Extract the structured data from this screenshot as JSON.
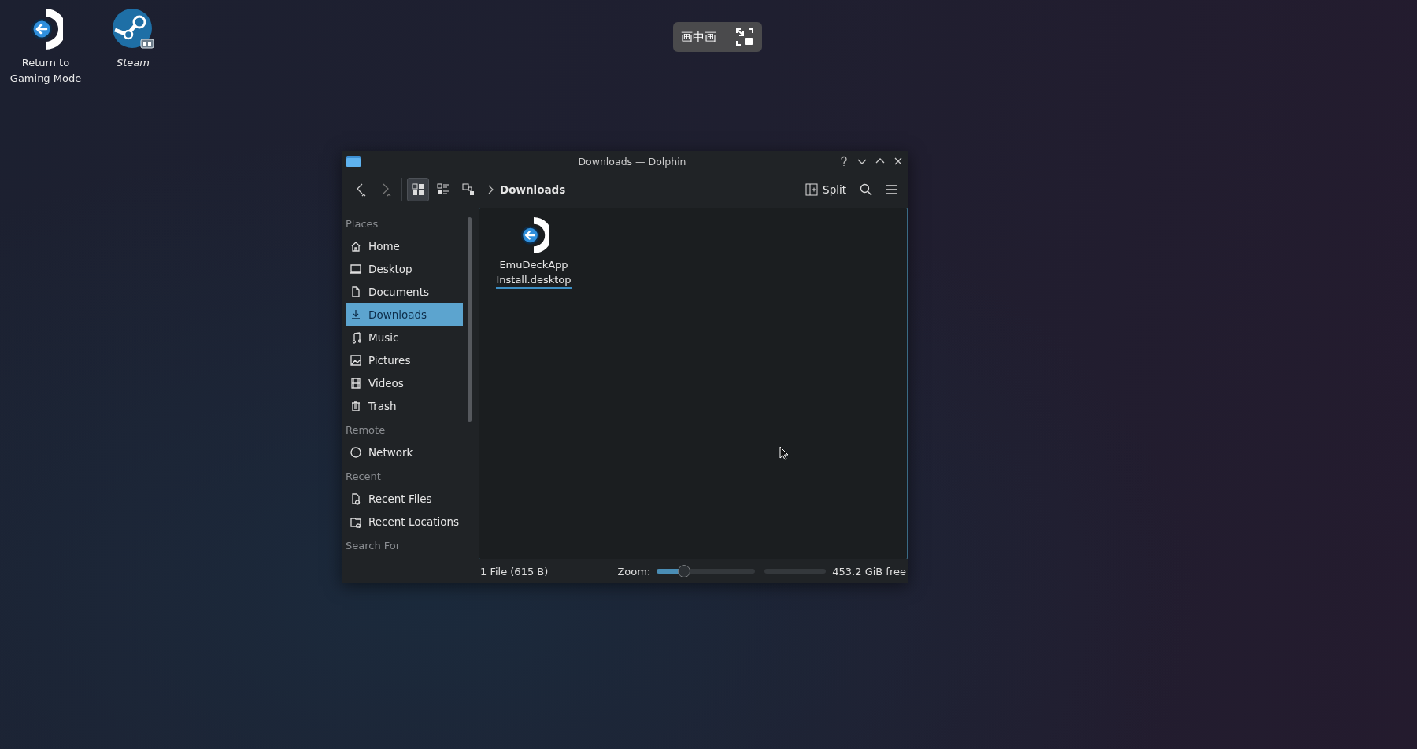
{
  "desktop_icons": [
    {
      "label": "Return to\nGaming Mode",
      "kind": "return"
    },
    {
      "label": "Steam",
      "kind": "steam"
    }
  ],
  "pip_bar": {
    "label": "画中画"
  },
  "window": {
    "title": "Downloads — Dolphin"
  },
  "toolbar": {
    "view_modes": [
      {
        "selected": true
      },
      {
        "selected": false
      },
      {
        "selected": false
      }
    ],
    "breadcrumb": "Downloads",
    "split_button": "Split"
  },
  "sidebar": {
    "sections": [
      {
        "heading": "Places",
        "items": [
          {
            "label": "Home",
            "selected": false
          },
          {
            "label": "Desktop",
            "selected": false
          },
          {
            "label": "Documents",
            "selected": false
          },
          {
            "label": "Downloads",
            "selected": true
          },
          {
            "label": "Music",
            "selected": false
          },
          {
            "label": "Pictures",
            "selected": false
          },
          {
            "label": "Videos",
            "selected": false
          },
          {
            "label": "Trash",
            "selected": false
          }
        ]
      },
      {
        "heading": "Remote",
        "items": [
          {
            "label": "Network",
            "selected": false
          }
        ]
      },
      {
        "heading": "Recent",
        "items": [
          {
            "label": "Recent Files",
            "selected": false
          },
          {
            "label": "Recent Locations",
            "selected": false
          }
        ]
      },
      {
        "heading": "Search For"
      }
    ]
  },
  "files": [
    {
      "name": "EmuDeckApp\nInstall.desktop",
      "selected": true
    }
  ],
  "status_bar": {
    "summary": "1 File (615 B)",
    "zoom_label": "Zoom:",
    "zoom": {
      "level": 0.28
    },
    "free_space": "453.2 GiB free"
  }
}
